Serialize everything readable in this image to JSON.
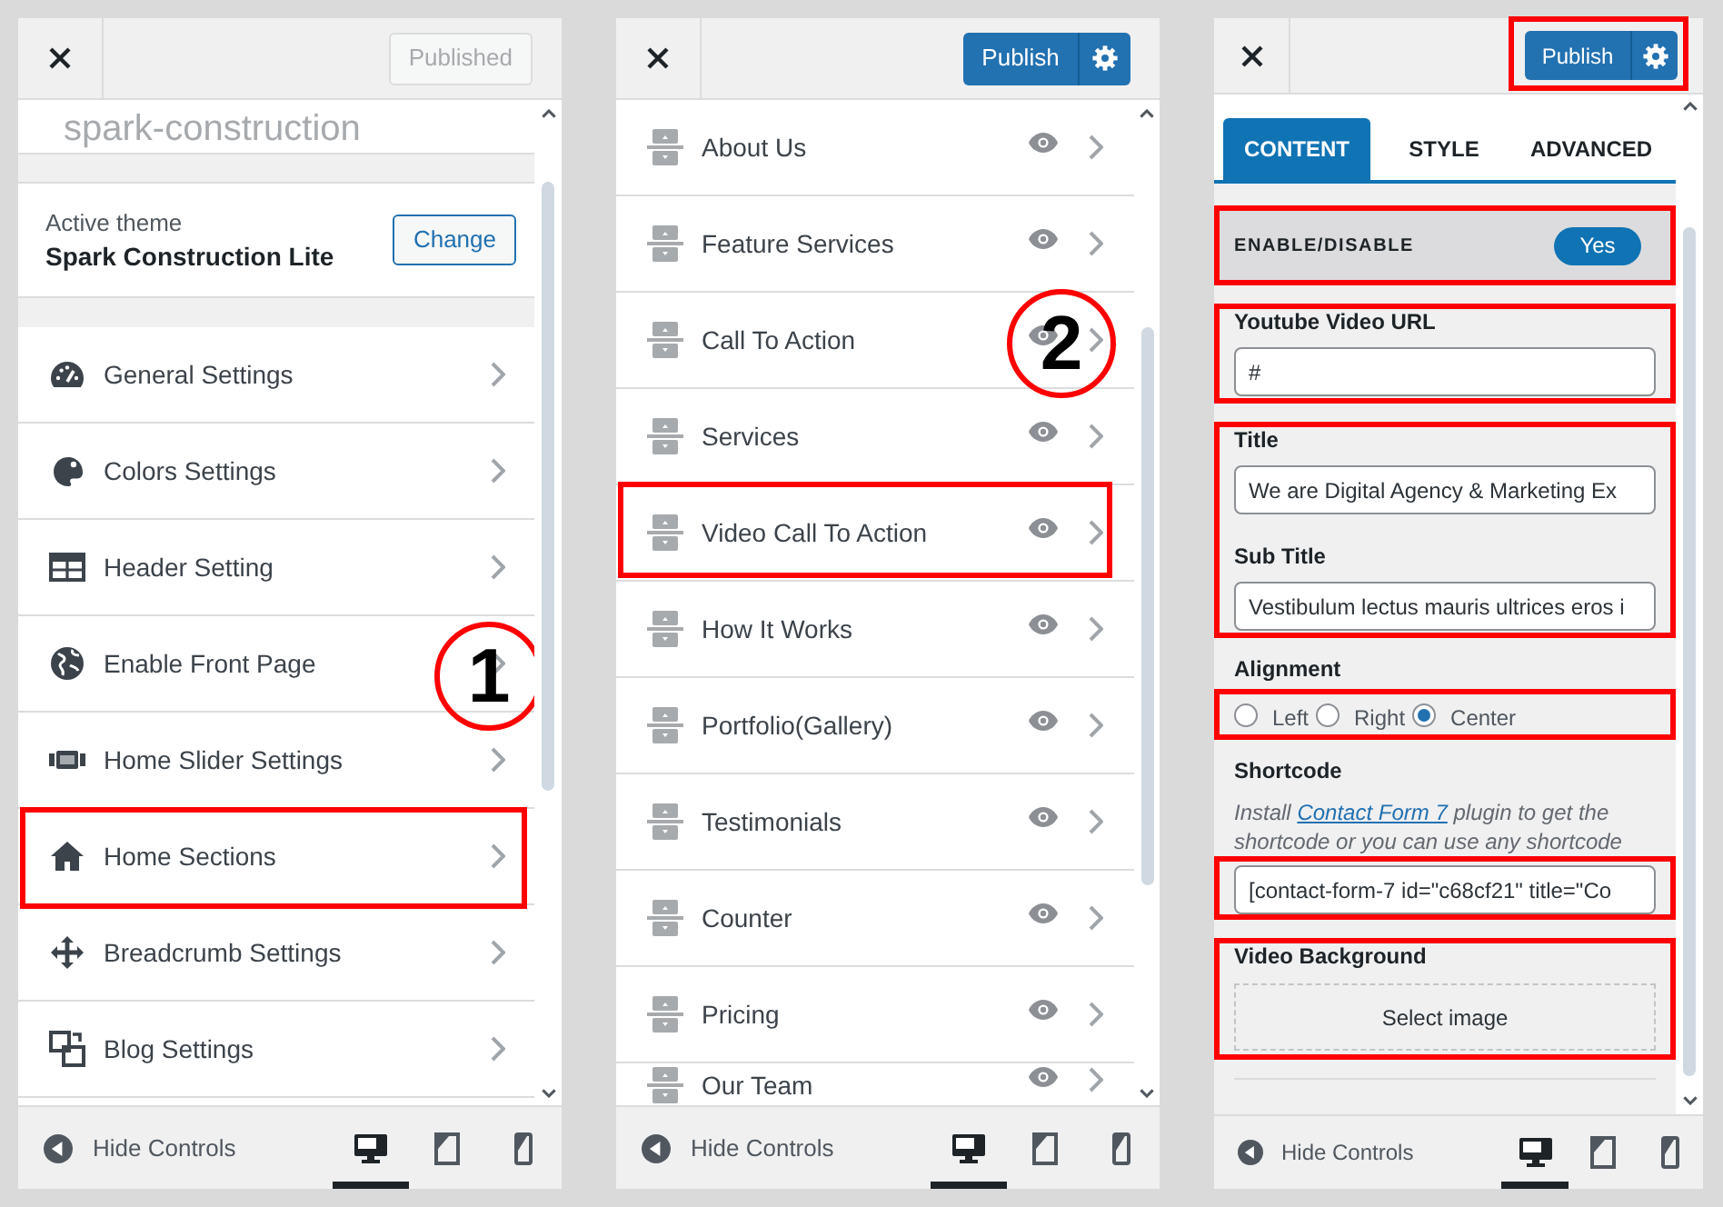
{
  "customizer_panel": {
    "publish_button": {
      "label": "Published",
      "disabled": true,
      "highlighted": false
    },
    "site_title": "spark-construction",
    "active_theme": {
      "caption": "Active theme",
      "name": "Spark Construction Lite",
      "button": "Change"
    },
    "menu": [
      {
        "label": "General Settings",
        "highlighted": false
      },
      {
        "label": "Colors Settings",
        "highlighted": false
      },
      {
        "label": "Header Setting",
        "highlighted": false
      },
      {
        "label": "Enable Front Page",
        "highlighted": false,
        "callout": "1"
      },
      {
        "label": "Home Slider Settings",
        "highlighted": false
      },
      {
        "label": "Home Sections",
        "highlighted": true
      },
      {
        "label": "Breadcrumb Settings",
        "highlighted": false
      },
      {
        "label": "Blog Settings",
        "highlighted": false
      }
    ],
    "footer": {
      "label": "Hide Controls",
      "devices": [
        {
          "kind": "desktop",
          "selected": true
        },
        {
          "kind": "tablet",
          "selected": false
        },
        {
          "kind": "mobile",
          "selected": false
        }
      ]
    }
  },
  "sections_panel": {
    "publish_button": {
      "label": "Publish",
      "disabled": false,
      "highlighted": false
    },
    "sections": [
      {
        "label": "About Us",
        "highlighted": false
      },
      {
        "label": "Feature Services",
        "highlighted": false
      },
      {
        "label": "Call To Action",
        "highlighted": false,
        "callout": "2"
      },
      {
        "label": "Services",
        "highlighted": false
      },
      {
        "label": "Video Call To Action",
        "highlighted": true
      },
      {
        "label": "How It Works",
        "highlighted": false
      },
      {
        "label": "Portfolio(Gallery)",
        "highlighted": false
      },
      {
        "label": "Testimonials",
        "highlighted": false
      },
      {
        "label": "Counter",
        "highlighted": false
      },
      {
        "label": "Pricing",
        "highlighted": false
      },
      {
        "label": "Our Team",
        "highlighted": false
      }
    ],
    "footer": {
      "label": "Hide Controls",
      "devices": [
        {
          "kind": "desktop",
          "selected": true
        },
        {
          "kind": "tablet",
          "selected": false
        },
        {
          "kind": "mobile",
          "selected": false
        }
      ]
    }
  },
  "editor_panel": {
    "publish_button": {
      "label": "Publish",
      "disabled": false,
      "highlighted": true
    },
    "tabs": [
      {
        "label": "CONTENT",
        "selected": true
      },
      {
        "label": "STYLE",
        "selected": false
      },
      {
        "label": "ADVANCED",
        "selected": false
      }
    ],
    "controls": [
      {
        "kind": "toggle",
        "label": "ENABLE/DISABLE",
        "value": "Yes",
        "on": true,
        "highlighted": true
      },
      {
        "kind": "text",
        "fields": [
          {
            "label": "Youtube Video URL",
            "value": "#"
          }
        ],
        "highlighted": true
      },
      {
        "kind": "text",
        "fields": [
          {
            "label": "Title",
            "value": "We are Digital Agency & Marketing Ex"
          },
          {
            "label": "Sub Title",
            "value": "Vestibulum lectus mauris ultrices eros i"
          }
        ],
        "highlighted": true
      },
      {
        "kind": "radio",
        "label": "Alignment",
        "options": [
          {
            "label": "Left",
            "selected": false
          },
          {
            "label": "Right",
            "selected": false
          },
          {
            "label": "Center",
            "selected": true
          }
        ],
        "highlighted": true
      },
      {
        "kind": "shortcode",
        "label": "Shortcode",
        "help": {
          "before": "Install ",
          "link": "Contact Form 7",
          "after": " plugin to get the shortcode or you can use any shortcode"
        },
        "value": "[contact-form-7 id=\"c68cf21\" title=\"Co",
        "highlighted": true
      },
      {
        "kind": "media",
        "label": "Video Background",
        "button": "Select image",
        "highlighted": true
      }
    ],
    "footer": {
      "label": "Hide Controls",
      "devices": [
        {
          "kind": "desktop",
          "selected": true
        },
        {
          "kind": "tablet",
          "selected": false
        },
        {
          "kind": "mobile",
          "selected": false
        }
      ]
    }
  }
}
